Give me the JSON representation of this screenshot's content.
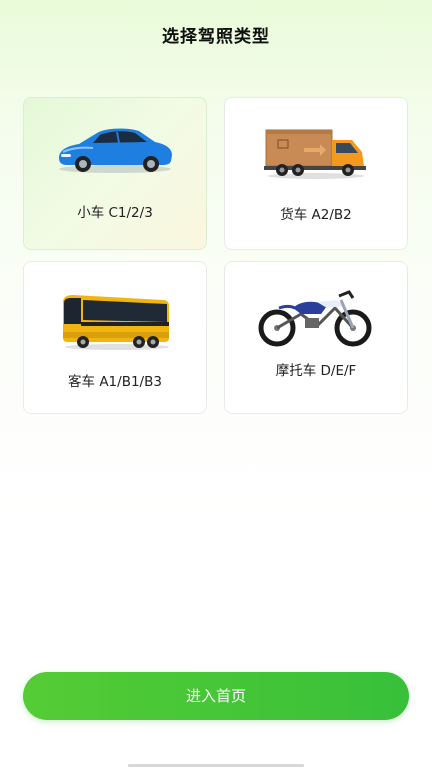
{
  "header": {
    "title": "选择驾照类型"
  },
  "license_types": [
    {
      "label": "小车 C1/2/3",
      "icon": "car-icon",
      "selected": true
    },
    {
      "label": "货车 A2/B2",
      "icon": "truck-icon",
      "selected": false
    },
    {
      "label": "客车 A1/B1/B3",
      "icon": "bus-icon",
      "selected": false
    },
    {
      "label": "摩托车 D/E/F",
      "icon": "motorcycle-icon",
      "selected": false
    }
  ],
  "footer": {
    "enter_home_label": "进入首页"
  },
  "colors": {
    "accent_green": "#3fc43a",
    "selected_card_bg": "#e8f9dc",
    "car_blue": "#1e7fe0",
    "truck_orange": "#f39a1e",
    "bus_yellow": "#f2b50f"
  }
}
